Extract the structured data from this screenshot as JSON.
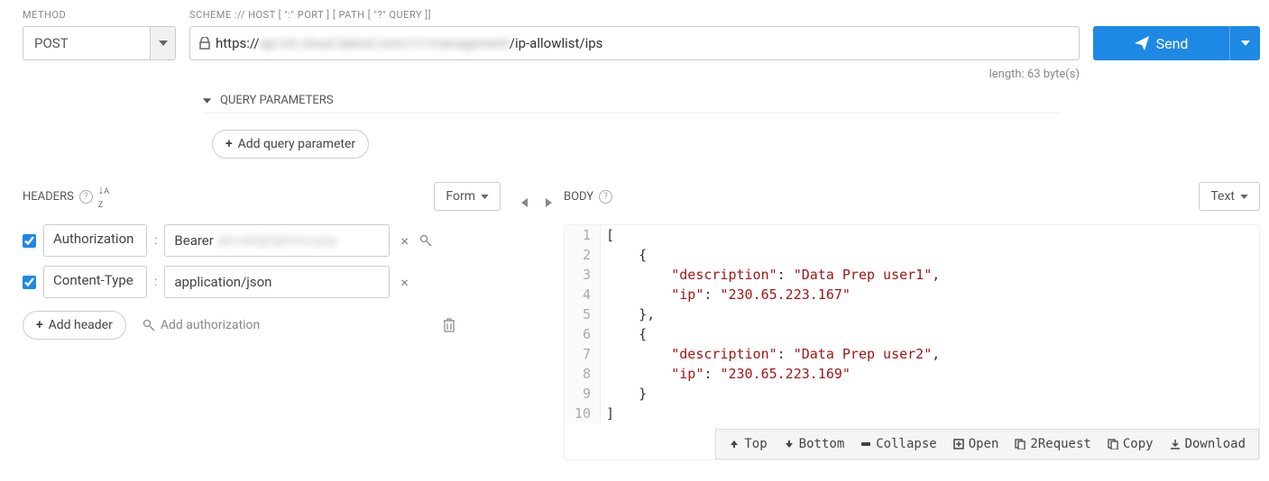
{
  "labels": {
    "method": "METHOD",
    "scheme": "SCHEME :// HOST [ \":\" PORT ] [ PATH [ \"?\" QUERY ]]",
    "headers": "HEADERS",
    "body": "BODY",
    "query_params": "QUERY PARAMETERS"
  },
  "method": {
    "value": "POST"
  },
  "url": {
    "prefix": "https://",
    "hidden": "api.int.cloud.talend.com/v1/management",
    "suffix": "/ip-allowlist/ips",
    "length_text": "length: 63 byte(s)"
  },
  "send": {
    "label": "Send"
  },
  "buttons": {
    "add_query_param": "Add query parameter",
    "add_header": "Add header",
    "add_auth": "Add authorization",
    "form": "Form",
    "text": "Text"
  },
  "headers": [
    {
      "name": "Authorization",
      "value_prefix": "Bearer ",
      "value_hidden": "abcdefghijklmnopqr",
      "checked": true,
      "has_mag": true
    },
    {
      "name": "Content-Type",
      "value_prefix": "application/json",
      "value_hidden": "",
      "checked": true,
      "has_mag": false
    }
  ],
  "body_lines": [
    {
      "n": 1,
      "tokens": [
        {
          "t": "[",
          "c": "punct"
        }
      ]
    },
    {
      "n": 2,
      "tokens": [
        {
          "t": "    {",
          "c": "punct"
        }
      ]
    },
    {
      "n": 3,
      "tokens": [
        {
          "t": "        ",
          "c": "punct"
        },
        {
          "t": "\"description\"",
          "c": "str"
        },
        {
          "t": ": ",
          "c": "punct"
        },
        {
          "t": "\"Data Prep user1\"",
          "c": "str"
        },
        {
          "t": ",",
          "c": "punct"
        }
      ]
    },
    {
      "n": 4,
      "tokens": [
        {
          "t": "        ",
          "c": "punct"
        },
        {
          "t": "\"ip\"",
          "c": "str"
        },
        {
          "t": ": ",
          "c": "punct"
        },
        {
          "t": "\"230.65.223.167\"",
          "c": "str"
        }
      ]
    },
    {
      "n": 5,
      "tokens": [
        {
          "t": "    },",
          "c": "punct"
        }
      ]
    },
    {
      "n": 6,
      "tokens": [
        {
          "t": "    {",
          "c": "punct"
        }
      ]
    },
    {
      "n": 7,
      "tokens": [
        {
          "t": "        ",
          "c": "punct"
        },
        {
          "t": "\"description\"",
          "c": "str"
        },
        {
          "t": ": ",
          "c": "punct"
        },
        {
          "t": "\"Data Prep user2\"",
          "c": "str"
        },
        {
          "t": ",",
          "c": "punct"
        }
      ]
    },
    {
      "n": 8,
      "tokens": [
        {
          "t": "        ",
          "c": "punct"
        },
        {
          "t": "\"ip\"",
          "c": "str"
        },
        {
          "t": ": ",
          "c": "punct"
        },
        {
          "t": "\"230.65.223.169\"",
          "c": "str"
        }
      ]
    },
    {
      "n": 9,
      "tokens": [
        {
          "t": "    }",
          "c": "punct"
        }
      ]
    },
    {
      "n": 10,
      "tokens": [
        {
          "t": "]",
          "c": "punct"
        }
      ]
    }
  ],
  "toolbar": {
    "top": "Top",
    "bottom": "Bottom",
    "collapse": "Collapse",
    "open": "Open",
    "request": "2Request",
    "copy": "Copy",
    "download": "Download"
  }
}
